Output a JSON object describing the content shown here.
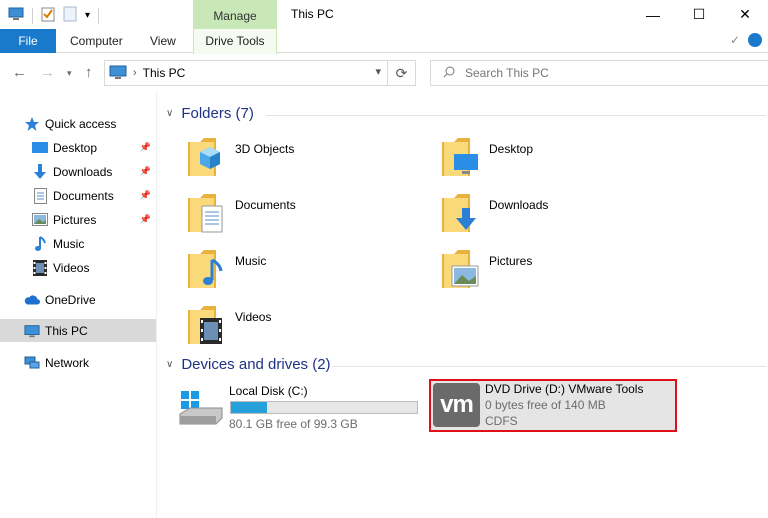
{
  "window": {
    "title": "This PC",
    "contextual_tab": "Manage",
    "minimize_glyph": "—",
    "maximize_glyph": "☐",
    "close_glyph": "✕"
  },
  "ribbon": {
    "tabs": [
      "File",
      "Computer",
      "View",
      "Drive Tools"
    ]
  },
  "address": {
    "path": "This PC",
    "search_placeholder": "Search This PC"
  },
  "sidebar": {
    "quick_access": "Quick access",
    "quick_items": [
      {
        "label": "Desktop",
        "icon": "desktop-icon"
      },
      {
        "label": "Downloads",
        "icon": "downloads-icon"
      },
      {
        "label": "Documents",
        "icon": "documents-icon"
      },
      {
        "label": "Pictures",
        "icon": "pictures-icon"
      },
      {
        "label": "Music",
        "icon": "music-icon"
      },
      {
        "label": "Videos",
        "icon": "videos-icon"
      }
    ],
    "onedrive": "OneDrive",
    "this_pc": "This PC",
    "network": "Network"
  },
  "folders": {
    "heading": "Folders (7)",
    "items": [
      "3D Objects",
      "Desktop",
      "Documents",
      "Downloads",
      "Music",
      "Pictures",
      "Videos"
    ]
  },
  "devices": {
    "heading": "Devices and drives (2)",
    "local": {
      "label": "Local Disk (C:)",
      "free": "80.1 GB free of 99.3 GB",
      "used_fraction": 0.193
    },
    "dvd": {
      "label": "DVD Drive (D:) VMware Tools",
      "free": "0 bytes free of 140 MB",
      "fs": "CDFS",
      "logo_text": "vm"
    }
  },
  "colors": {
    "accent": "#1979ca",
    "manage_tab": "#c9e8b7",
    "bar_fill": "#26a0da",
    "selection_border": "#e0101a",
    "heading": "#1e3287"
  }
}
